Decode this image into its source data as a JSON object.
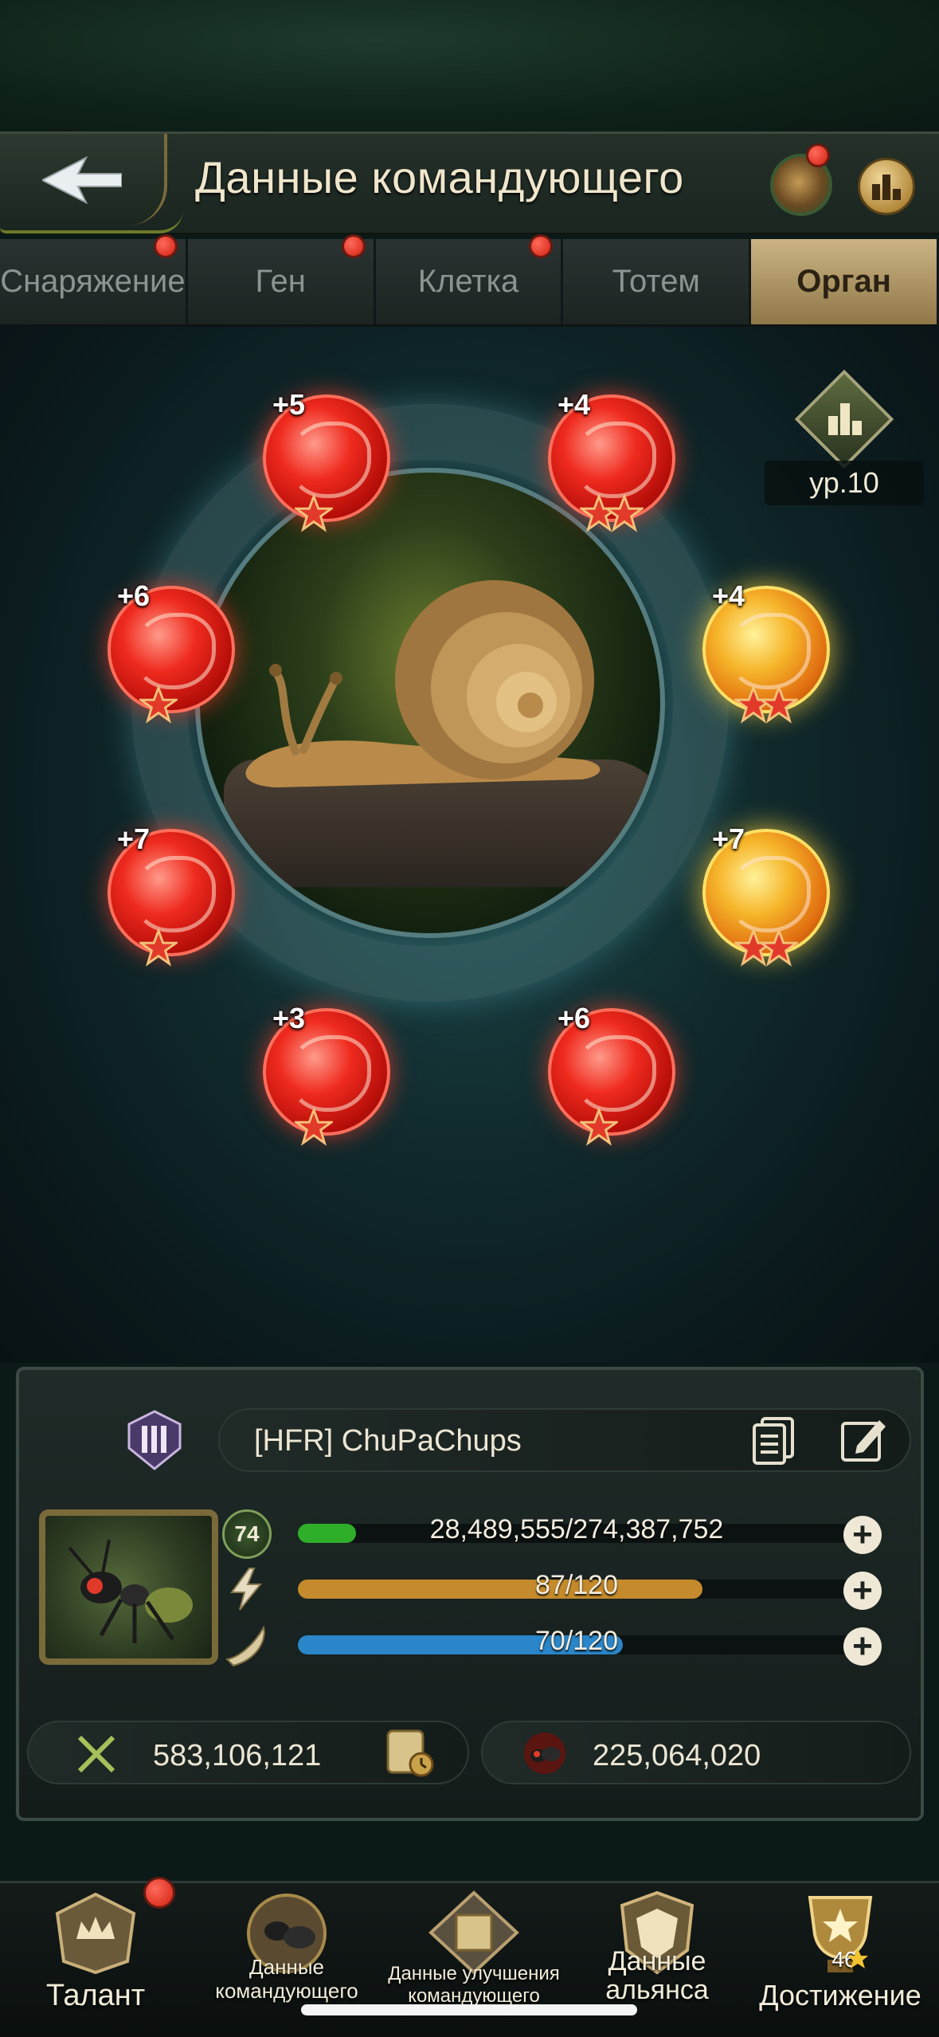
{
  "header": {
    "title": "Данные командующего"
  },
  "tabs": [
    {
      "label": "Снаряжение",
      "notify": true,
      "active": false
    },
    {
      "label": "Ген",
      "notify": true,
      "active": false
    },
    {
      "label": "Клетка",
      "notify": true,
      "active": false
    },
    {
      "label": "Тотем",
      "notify": false,
      "active": false
    },
    {
      "label": "Орган",
      "notify": false,
      "active": true
    }
  ],
  "organ_level": "ур.10",
  "organs": [
    {
      "bonus": "+5",
      "color": "red",
      "stars": 1
    },
    {
      "bonus": "+4",
      "color": "red",
      "stars": 2
    },
    {
      "bonus": "+6",
      "color": "red",
      "stars": 1
    },
    {
      "bonus": "+4",
      "color": "gold",
      "stars": 2
    },
    {
      "bonus": "+7",
      "color": "red",
      "stars": 1
    },
    {
      "bonus": "+7",
      "color": "gold",
      "stars": 2
    },
    {
      "bonus": "+3",
      "color": "red",
      "stars": 1
    },
    {
      "bonus": "+6",
      "color": "red",
      "stars": 1
    }
  ],
  "profile": {
    "name": "[HFR]  ChuPaChups",
    "level": "74",
    "exp_text": "28,489,555/274,387,752",
    "exp_fraction": 0.104,
    "energy_text": "87/120",
    "energy_fraction": 0.725,
    "stamina_text": "70/120",
    "stamina_fraction": 0.583,
    "power": "583,106,121",
    "kills": "225,064,020"
  },
  "nav": [
    {
      "label": "Талант",
      "notify": true
    },
    {
      "label": "Данные командующего"
    },
    {
      "label": "Данные улучшения командующего"
    },
    {
      "label": "Данные альянса"
    },
    {
      "label": "Достижение",
      "badge": "46"
    }
  ],
  "colors": {
    "exp": "#2fae2a",
    "energy": "#c58a2c",
    "stamina": "#2a86c8",
    "notify": "#e0291a",
    "accent": "#cbb483"
  }
}
